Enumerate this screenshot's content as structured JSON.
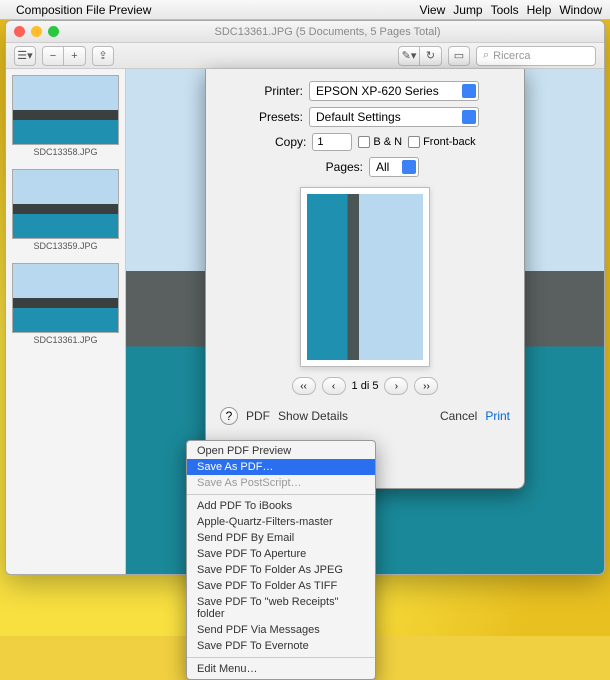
{
  "menubar": {
    "app": "Composition File Preview",
    "items": [
      "View",
      "Jump",
      "Tools",
      "Help",
      "Window"
    ]
  },
  "window": {
    "title": "SDC13361.JPG (5 Documents, 5 Pages Total)",
    "search_placeholder": "Ricerca"
  },
  "thumbnails": [
    {
      "label": "SDC13358.JPG"
    },
    {
      "label": "SDC13359.JPG"
    },
    {
      "label": "SDC13361.JPG"
    }
  ],
  "print": {
    "printer_label": "Printer:",
    "printer_value": "EPSON XP-620 Series",
    "presets_label": "Presets:",
    "presets_value": "Default Settings",
    "copy_label": "Copy:",
    "copy_value": "1",
    "bn_label": "B & N",
    "frontback_label": "Front-back",
    "pages_label": "Pages:",
    "pages_value": "All",
    "pager_text": "1 di 5",
    "pdf_label": "PDF",
    "details_label": "Show Details",
    "cancel_label": "Cancel",
    "print_label": "Print"
  },
  "pdf_menu": {
    "open": "Open PDF Preview",
    "save_as": "Save As PDF…",
    "postscript": "Save As PostScript…",
    "ibooks": "Add PDF To iBooks",
    "quartz": "Apple-Quartz-Filters-master",
    "email": "Send PDF By Email",
    "aperture": "Save PDF To Aperture",
    "jpeg": "Save PDF To Folder As JPEG",
    "tiff": "Save PDF To Folder As TIFF",
    "receipts": "Save PDF To \"web Receipts\" folder",
    "messages": "Send PDF Via Messages",
    "evernote": "Save PDF To Evernote",
    "edit": "Edit Menu…"
  }
}
